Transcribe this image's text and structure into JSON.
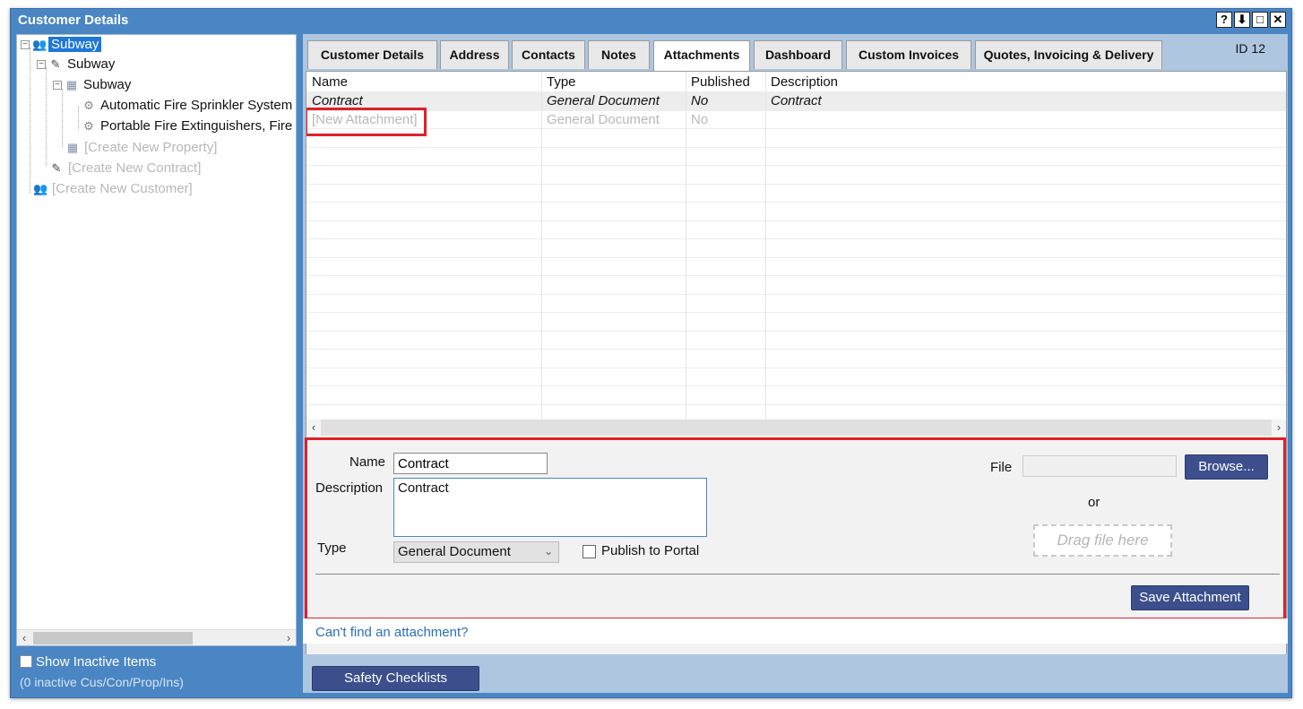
{
  "window": {
    "title": "Customer Details",
    "buttons": [
      "?",
      "⬇",
      "□",
      "✕"
    ]
  },
  "tree": {
    "items": [
      {
        "label": "Subway",
        "icon": "people-icon",
        "selected": true
      },
      {
        "label": "Subway",
        "icon": "contract-icon"
      },
      {
        "label": "Subway",
        "icon": "building-icon"
      },
      {
        "label": "Automatic Fire Sprinkler System",
        "icon": "gear-icon"
      },
      {
        "label": "Portable Fire Extinguishers, Fire",
        "icon": "gear-icon"
      },
      {
        "label": "[Create New Property]",
        "icon": "building-icon",
        "ghost": true
      },
      {
        "label": "[Create New Contract]",
        "icon": "contract-icon",
        "ghost": true
      },
      {
        "label": "[Create New Customer]",
        "icon": "people-icon",
        "ghost": true
      }
    ],
    "show_inactive_label": "Show Inactive Items",
    "inactive_count": "(0 inactive Cus/Con/Prop/Ins)"
  },
  "tabs": [
    {
      "label": "Customer Details"
    },
    {
      "label": "Address"
    },
    {
      "label": "Contacts"
    },
    {
      "label": "Notes"
    },
    {
      "label": "Attachments",
      "active": true
    },
    {
      "label": "Dashboard"
    },
    {
      "label": "Custom Invoices"
    },
    {
      "label": "Quotes, Invoicing & Delivery"
    }
  ],
  "id_label": "ID 12",
  "grid": {
    "columns": [
      "Name",
      "Type",
      "Published",
      "Description"
    ],
    "rows": [
      {
        "name": "Contract",
        "type": "General Document",
        "published": "No",
        "description": "Contract"
      },
      {
        "name": "[New Attachment]",
        "type": "General Document",
        "published": "No",
        "description": ""
      }
    ]
  },
  "form": {
    "name_label": "Name",
    "name_value": "Contract",
    "description_label": "Description",
    "description_value": "Contract",
    "type_label": "Type",
    "type_value": "General Document",
    "publish_label": "Publish to Portal",
    "file_label": "File",
    "browse_label": "Browse...",
    "or_label": "or",
    "drag_label": "Drag file here",
    "save_label": "Save Attachment"
  },
  "cant_find_link": "Can't find an attachment?",
  "safety_checklists_label": "Safety Checklists",
  "colors": {
    "window_blue": "#4a86c4",
    "selected_blue": "#1e78d6",
    "button_navy": "#3c4f8c",
    "highlight_red": "#e0202a"
  }
}
